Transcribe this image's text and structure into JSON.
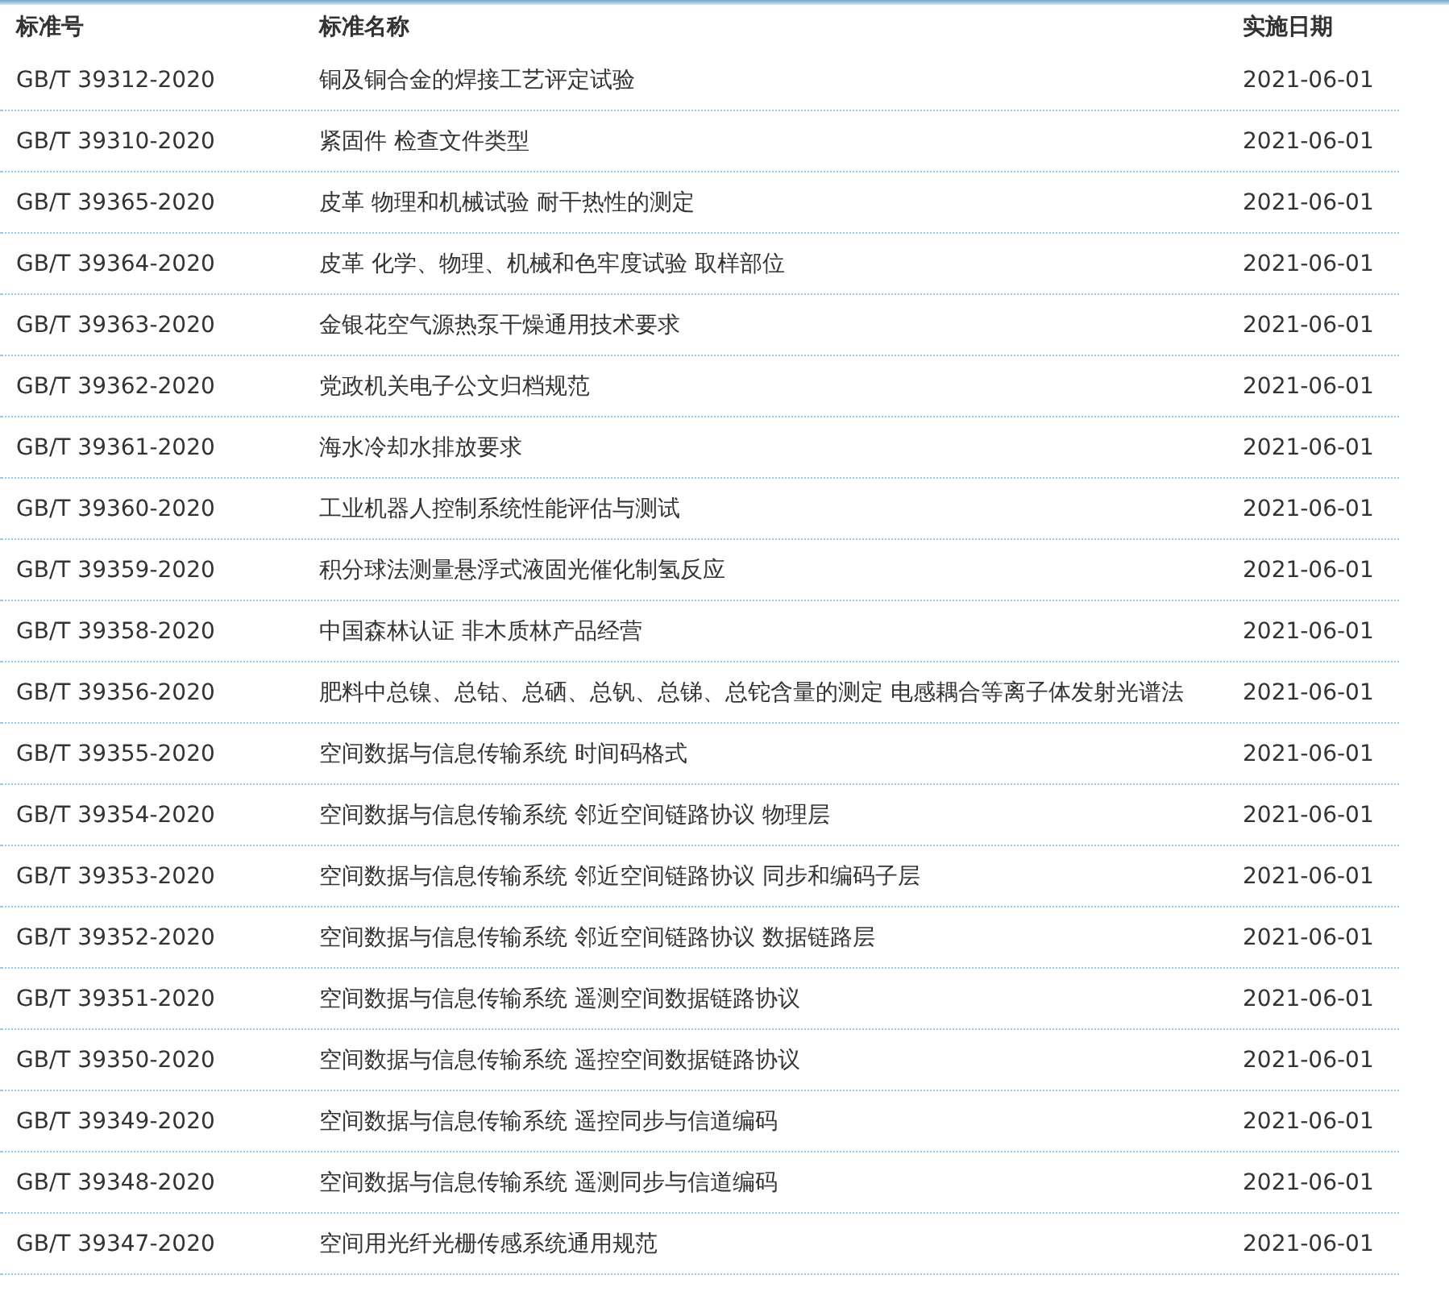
{
  "table": {
    "columns": [
      "标准号",
      "标准名称",
      "实施日期"
    ],
    "rows": [
      [
        "GB/T 39312-2020",
        "铜及铜合金的焊接工艺评定试验",
        "2021-06-01"
      ],
      [
        "GB/T 39310-2020",
        "紧固件 检查文件类型",
        "2021-06-01"
      ],
      [
        "GB/T 39365-2020",
        "皮革 物理和机械试验 耐干热性的测定",
        "2021-06-01"
      ],
      [
        "GB/T 39364-2020",
        "皮革 化学、物理、机械和色牢度试验 取样部位",
        "2021-06-01"
      ],
      [
        "GB/T 39363-2020",
        "金银花空气源热泵干燥通用技术要求",
        "2021-06-01"
      ],
      [
        "GB/T 39362-2020",
        "党政机关电子公文归档规范",
        "2021-06-01"
      ],
      [
        "GB/T 39361-2020",
        "海水冷却水排放要求",
        "2021-06-01"
      ],
      [
        "GB/T 39360-2020",
        "工业机器人控制系统性能评估与测试",
        "2021-06-01"
      ],
      [
        "GB/T 39359-2020",
        "积分球法测量悬浮式液固光催化制氢反应",
        "2021-06-01"
      ],
      [
        "GB/T 39358-2020",
        "中国森林认证 非木质林产品经营",
        "2021-06-01"
      ],
      [
        "GB/T 39356-2020",
        "肥料中总镍、总钴、总硒、总钒、总锑、总铊含量的测定 电感耦合等离子体发射光谱法",
        "2021-06-01"
      ],
      [
        "GB/T 39355-2020",
        "空间数据与信息传输系统 时间码格式",
        "2021-06-01"
      ],
      [
        "GB/T 39354-2020",
        "空间数据与信息传输系统 邻近空间链路协议 物理层",
        "2021-06-01"
      ],
      [
        "GB/T 39353-2020",
        "空间数据与信息传输系统 邻近空间链路协议 同步和编码子层",
        "2021-06-01"
      ],
      [
        "GB/T 39352-2020",
        "空间数据与信息传输系统 邻近空间链路协议 数据链路层",
        "2021-06-01"
      ],
      [
        "GB/T 39351-2020",
        "空间数据与信息传输系统 遥测空间数据链路协议",
        "2021-06-01"
      ],
      [
        "GB/T 39350-2020",
        "空间数据与信息传输系统 遥控空间数据链路协议",
        "2021-06-01"
      ],
      [
        "GB/T 39349-2020",
        "空间数据与信息传输系统 遥控同步与信道编码",
        "2021-06-01"
      ],
      [
        "GB/T 39348-2020",
        "空间数据与信息传输系统 遥测同步与信道编码",
        "2021-06-01"
      ],
      [
        "GB/T 39347-2020",
        "空间用光纤光栅传感系统通用规范",
        "2021-06-01"
      ]
    ]
  }
}
